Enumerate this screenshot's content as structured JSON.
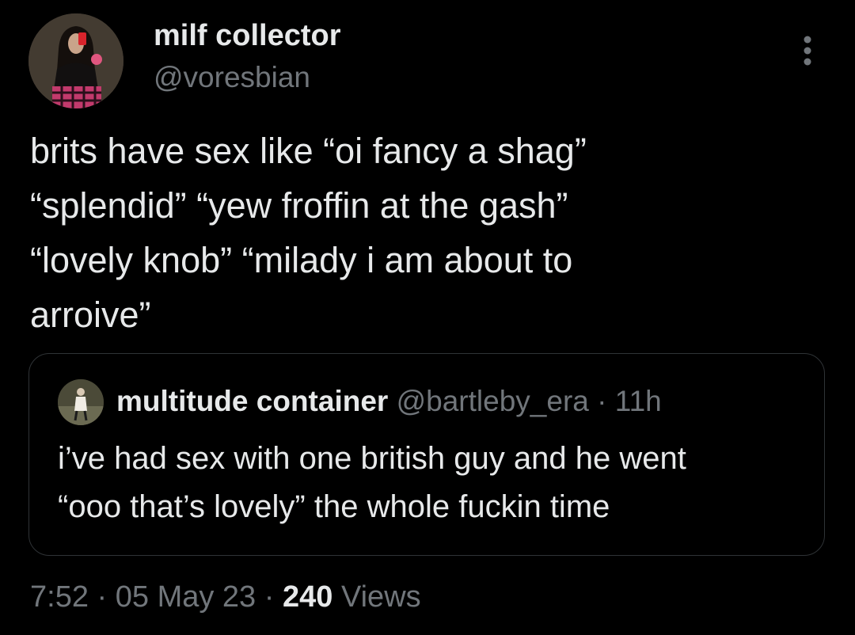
{
  "author": {
    "display_name": "milf collector",
    "handle": "@voresbian",
    "avatar_icon": "profile-photo"
  },
  "tweet": {
    "text": "brits have sex like “oi fancy a shag”\n“splendid” “yew froffin at the gash”\n“lovely knob” “milady i am about to\narroive”"
  },
  "quoted_tweet": {
    "display_name": "multitude container",
    "handle": "@bartleby_era",
    "separator": "·",
    "time": "11h",
    "text": "i’ve had sex with one british guy and he went\n“ooo that’s lovely” the whole fuckin time"
  },
  "meta": {
    "time": "7:52",
    "date": "05 May 23",
    "separator": "·",
    "views_count": "240",
    "views_label": "Views"
  },
  "colors": {
    "background": "#000000",
    "text_primary": "#e7e9ea",
    "text_secondary": "#71767b",
    "border": "#2f3336"
  },
  "icons": {
    "more": "more-vertical-icon"
  }
}
